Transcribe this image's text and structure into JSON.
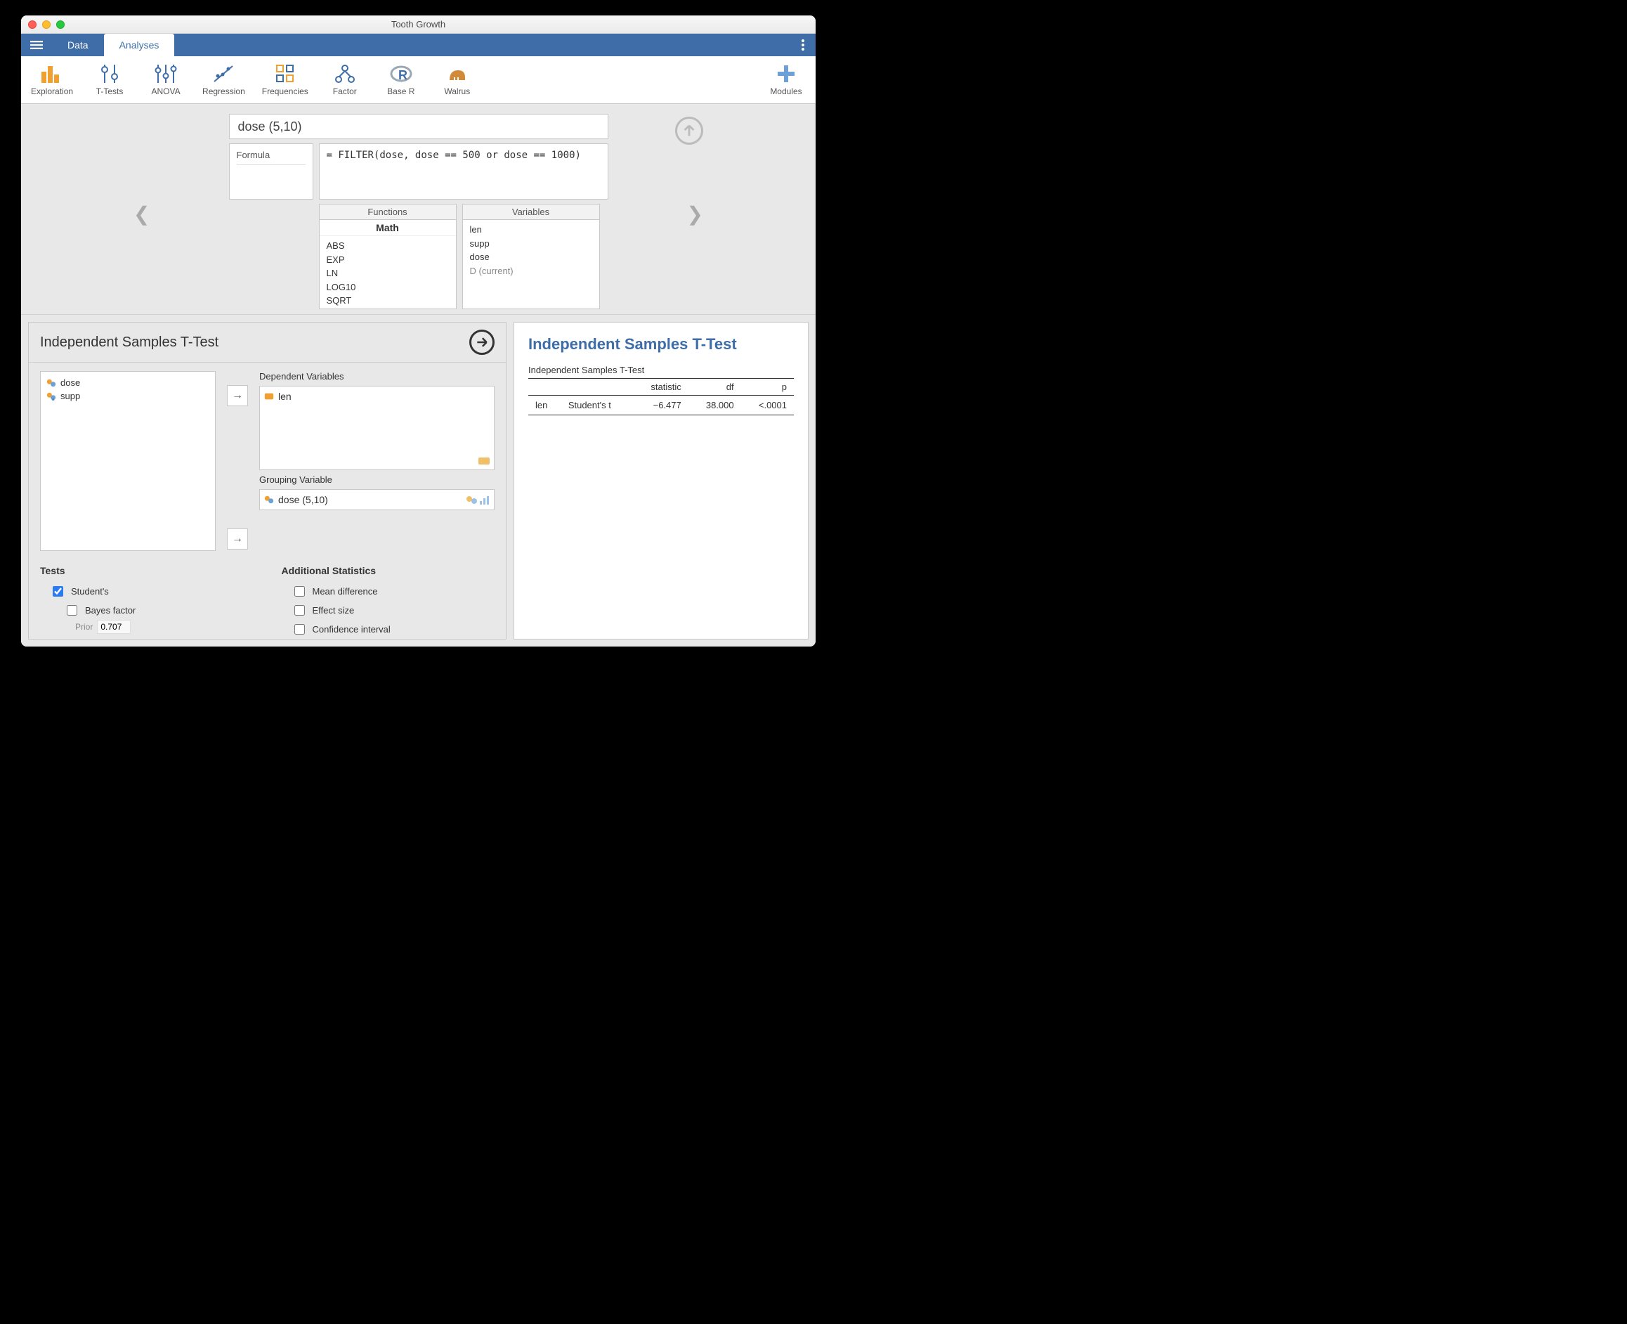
{
  "window": {
    "title": "Tooth Growth"
  },
  "tabs": {
    "data": "Data",
    "analyses": "Analyses"
  },
  "toolbar": {
    "exploration": "Exploration",
    "ttests": "T-Tests",
    "anova": "ANOVA",
    "regression": "Regression",
    "frequencies": "Frequencies",
    "factor": "Factor",
    "baser": "Base R",
    "walrus": "Walrus",
    "modules": "Modules"
  },
  "formula": {
    "name": "dose (5,10)",
    "side_label": "Formula",
    "code": "= FILTER(dose, dose == 500 or dose == 1000)",
    "functions_header": "Functions",
    "functions_group": "Math",
    "functions": [
      "ABS",
      "EXP",
      "LN",
      "LOG10",
      "SQRT"
    ],
    "variables_header": "Variables",
    "variables": [
      "len",
      "supp",
      "dose"
    ],
    "variables_current": "D (current)"
  },
  "options": {
    "title": "Independent Samples T-Test",
    "source_vars": [
      "dose",
      "supp"
    ],
    "dep_label": "Dependent Variables",
    "dep_vars": [
      "len"
    ],
    "group_label": "Grouping Variable",
    "group_var": "dose (5,10)",
    "tests_header": "Tests",
    "students": "Student's",
    "bayes": "Bayes factor",
    "prior_label": "Prior",
    "prior_value": "0.707",
    "addl_header": "Additional Statistics",
    "meandiff": "Mean difference",
    "effsize": "Effect size",
    "ci": "Confidence interval"
  },
  "results": {
    "heading": "Independent Samples T-Test",
    "table_title": "Independent Samples T-Test",
    "cols": {
      "stat": "statistic",
      "df": "df",
      "p": "p"
    },
    "row": {
      "var": "len",
      "test": "Student's t",
      "statistic": "−6.477",
      "df": "38.000",
      "p": "<.0001"
    }
  }
}
